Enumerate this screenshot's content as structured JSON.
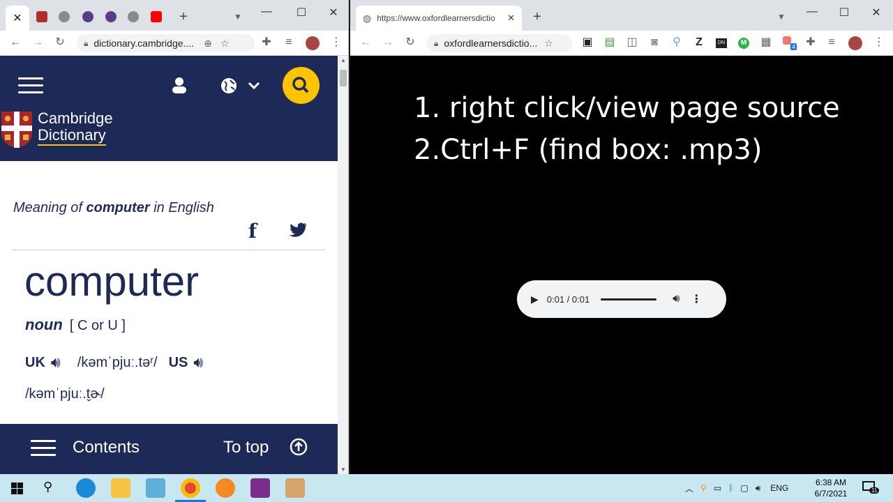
{
  "left_browser": {
    "url": "dictionary.cambridge....",
    "tabs": [
      "close",
      "cambridge",
      "globe",
      "brave1",
      "brave2",
      "globe2",
      "youtube"
    ],
    "new_tab": "+"
  },
  "cambridge": {
    "logo_line1": "Cambridge",
    "logo_line2": "Dictionary",
    "meaning_prefix": "Meaning of ",
    "meaning_word": "computer",
    "meaning_suffix": " in English",
    "headword": "computer",
    "pos": "noun",
    "grammar": "[ C or U ]",
    "uk_label": "UK",
    "uk_ipa": "/kəmˈpjuː.təʳ/",
    "us_label": "US",
    "us_ipa": "/kəmˈpjuː.t̬ɚ/",
    "footer_contents": "Contents",
    "footer_totop": "To top"
  },
  "right_browser": {
    "tab_title": "https://www.oxfordlearnersdictio",
    "url": "oxfordlearnersdictio...",
    "instruction1": "1. right click/view page source",
    "instruction2": "2.Ctrl+F (find box: .mp3)",
    "player_time": "0:01 / 0:01",
    "ext_badge": "4"
  },
  "taskbar": {
    "lang": "ENG",
    "time": "6:38 AM",
    "date": "6/7/2021",
    "notif_count": "11"
  },
  "colors": {
    "cambridge_navy": "#1d2a57",
    "search_yellow": "#fec400",
    "taskbar_bg": "#c9e7f0"
  }
}
